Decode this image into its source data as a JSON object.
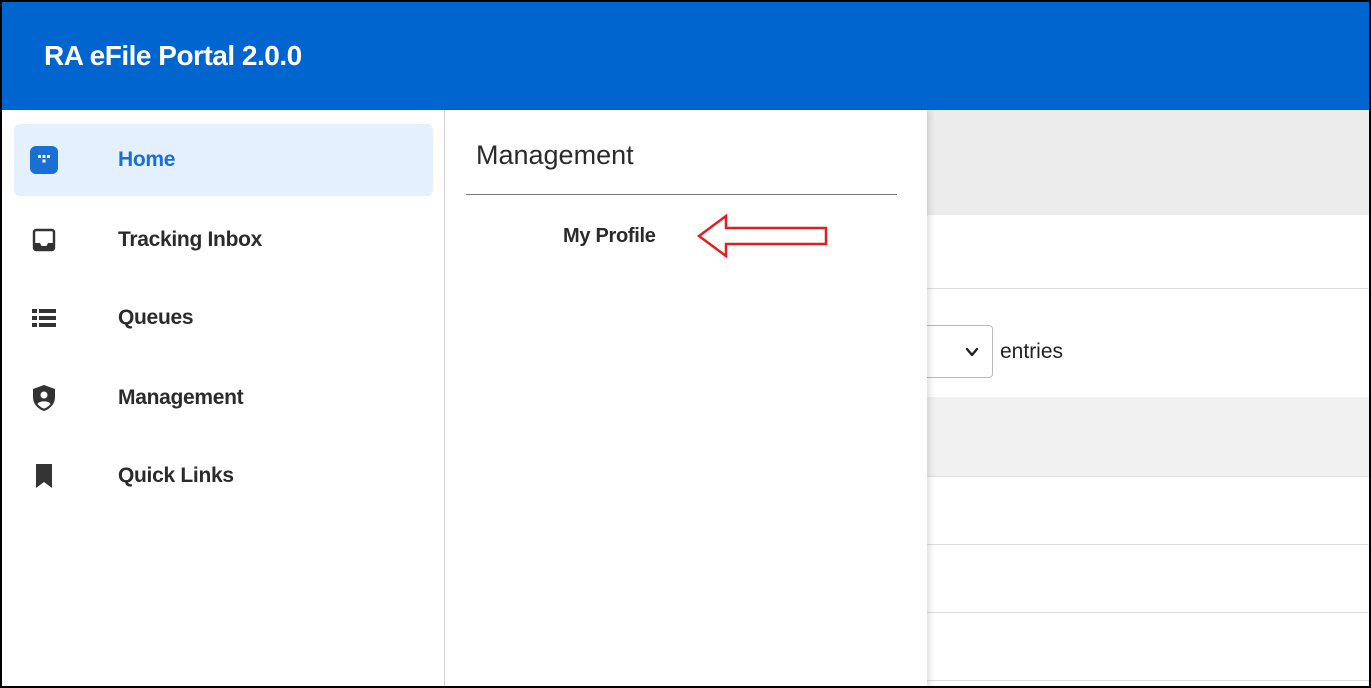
{
  "app": {
    "title": "RA eFile Portal 2.0.0"
  },
  "sidebar": {
    "items": [
      {
        "label": "Home",
        "icon": "home-grid-icon",
        "active": true
      },
      {
        "label": "Tracking Inbox",
        "icon": "inbox-icon",
        "active": false
      },
      {
        "label": "Queues",
        "icon": "list-icon",
        "active": false
      },
      {
        "label": "Management",
        "icon": "shield-user-icon",
        "active": false
      },
      {
        "label": "Quick Links",
        "icon": "bookmark-icon",
        "active": false
      }
    ]
  },
  "flyout": {
    "title": "Management",
    "links": [
      {
        "label": "My Profile"
      }
    ]
  },
  "content": {
    "entries_label": "entries"
  },
  "colors": {
    "topbar": "#0065cf",
    "active_item_bg": "#e4f0fd",
    "active_text": "#1a6fd4",
    "annotation_arrow": "#e02020"
  }
}
